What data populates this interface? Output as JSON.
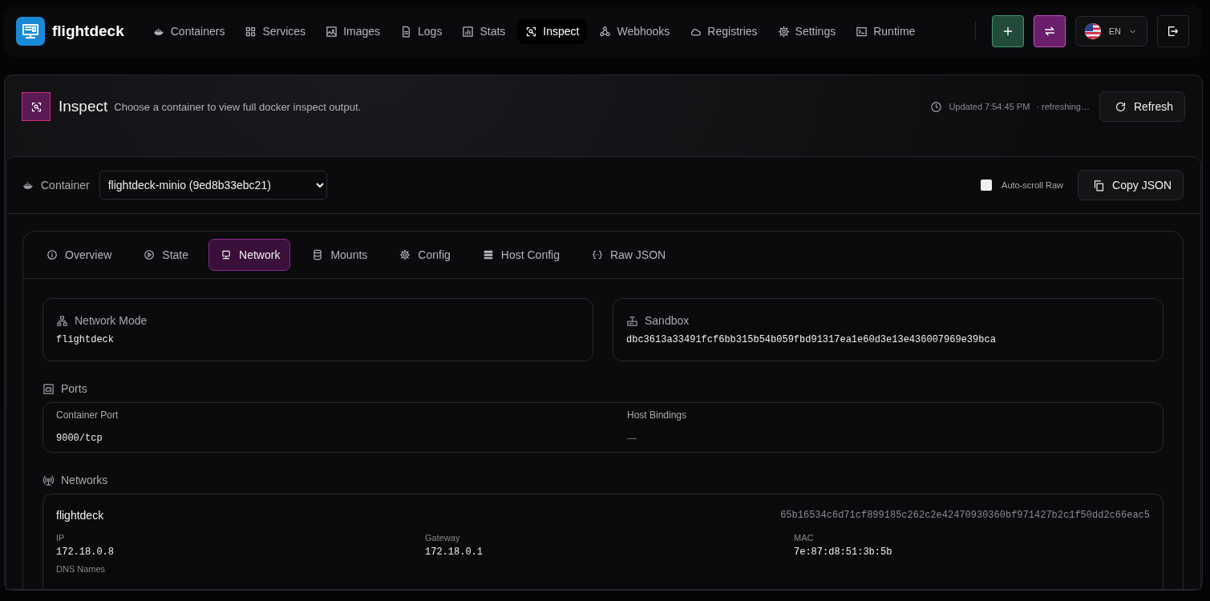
{
  "brand": {
    "name": "flightdeck"
  },
  "nav": [
    {
      "label": "Containers",
      "kind": "whale",
      "selected": false
    },
    {
      "label": "Services",
      "kind": "grid",
      "selected": false
    },
    {
      "label": "Images",
      "kind": "image",
      "selected": false
    },
    {
      "label": "Logs",
      "kind": "document",
      "selected": false
    },
    {
      "label": "Stats",
      "kind": "bars",
      "selected": false
    },
    {
      "label": "Inspect",
      "kind": "scan",
      "selected": true
    },
    {
      "label": "Webhooks",
      "kind": "webhook",
      "selected": false
    },
    {
      "label": "Registries",
      "kind": "cloud",
      "selected": false
    },
    {
      "label": "Settings",
      "kind": "gear",
      "selected": false
    },
    {
      "label": "Runtime",
      "kind": "terminal",
      "selected": false
    }
  ],
  "language": {
    "code": "EN"
  },
  "page": {
    "title": "Inspect",
    "subtitle": "Choose a container to view full docker inspect output.",
    "updated": "Updated 7:54:45 PM",
    "status": "· refreshing…",
    "refresh_button": "Refresh"
  },
  "toolbar": {
    "container_label": "Container",
    "container_value": "flightdeck-minio (9ed8b33ebc21)",
    "auto_scroll": {
      "label": "Auto-scroll Raw",
      "checked": false
    },
    "copy_button": "Copy JSON"
  },
  "tabs": [
    {
      "label": "Overview",
      "kind": "info",
      "selected": false
    },
    {
      "label": "State",
      "kind": "play",
      "selected": false
    },
    {
      "label": "Network",
      "kind": "monitor",
      "selected": true
    },
    {
      "label": "Mounts",
      "kind": "database",
      "selected": false
    },
    {
      "label": "Config",
      "kind": "gear",
      "selected": false
    },
    {
      "label": "Host Config",
      "kind": "server",
      "selected": false
    },
    {
      "label": "Raw JSON",
      "kind": "braces",
      "selected": false
    }
  ],
  "summary": [
    {
      "label": "Network Mode",
      "kind": "sitemap",
      "value": "flightdeck"
    },
    {
      "label": "Sandbox",
      "kind": "router",
      "value": "dbc3613a33491fcf6bb315b54b059fbd91317ea1e60d3e13e436007969e39bca"
    }
  ],
  "ports": {
    "title": "Ports",
    "columns": [
      "Container Port",
      "Host Bindings"
    ],
    "rows": [
      [
        "9000/tcp",
        "—"
      ]
    ]
  },
  "networks": {
    "title": "Networks",
    "items": [
      {
        "name": "flightdeck",
        "id": "65b16534c6d71cf899185c262c2e42470930360bf971427b2c1f50dd2c66eac5",
        "fields": [
          {
            "label": "IP",
            "value": "172.18.0.8"
          },
          {
            "label": "Gateway",
            "value": "172.18.0.1"
          },
          {
            "label": "MAC",
            "value": "7e:87:d8:51:3b:5b"
          },
          {
            "label": "DNS Names"
          }
        ]
      }
    ]
  }
}
